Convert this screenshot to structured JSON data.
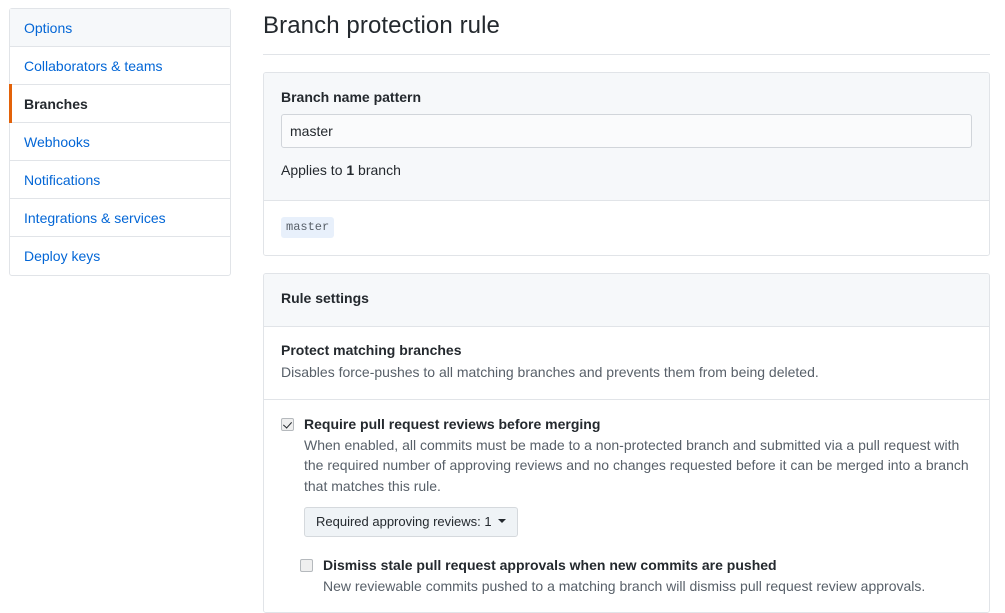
{
  "sidebar": {
    "items": [
      {
        "label": "Options",
        "active": false
      },
      {
        "label": "Collaborators & teams",
        "active": false
      },
      {
        "label": "Branches",
        "active": true
      },
      {
        "label": "Webhooks",
        "active": false
      },
      {
        "label": "Notifications",
        "active": false
      },
      {
        "label": "Integrations & services",
        "active": false
      },
      {
        "label": "Deploy keys",
        "active": false
      }
    ]
  },
  "page": {
    "title": "Branch protection rule"
  },
  "pattern_panel": {
    "field_label": "Branch name pattern",
    "input_value": "master",
    "input_placeholder": "Branch name pattern",
    "applies_prefix": "Applies to ",
    "applies_count": "1",
    "applies_suffix": " branch",
    "matched_branches": [
      "master"
    ]
  },
  "rule_settings": {
    "panel_title": "Rule settings",
    "protect": {
      "heading": "Protect matching branches",
      "description": "Disables force-pushes to all matching branches and prevents them from being deleted."
    },
    "require_reviews": {
      "checked": true,
      "label": "Require pull request reviews before merging",
      "description": "When enabled, all commits must be made to a non-protected branch and submitted via a pull request with the required number of approving reviews and no changes requested before it can be merged into a branch that matches this rule.",
      "dropdown_label": "Required approving reviews: 1"
    },
    "dismiss_stale": {
      "checked": false,
      "label": "Dismiss stale pull request approvals when new commits are pushed",
      "description": "New reviewable commits pushed to a matching branch will dismiss pull request review approvals."
    }
  },
  "colors": {
    "link": "#0366d6",
    "active_marker": "#e36209",
    "panel_header_bg": "#f6f8fa",
    "border": "#e1e4e8",
    "chip_bg": "#e8f0fb"
  }
}
